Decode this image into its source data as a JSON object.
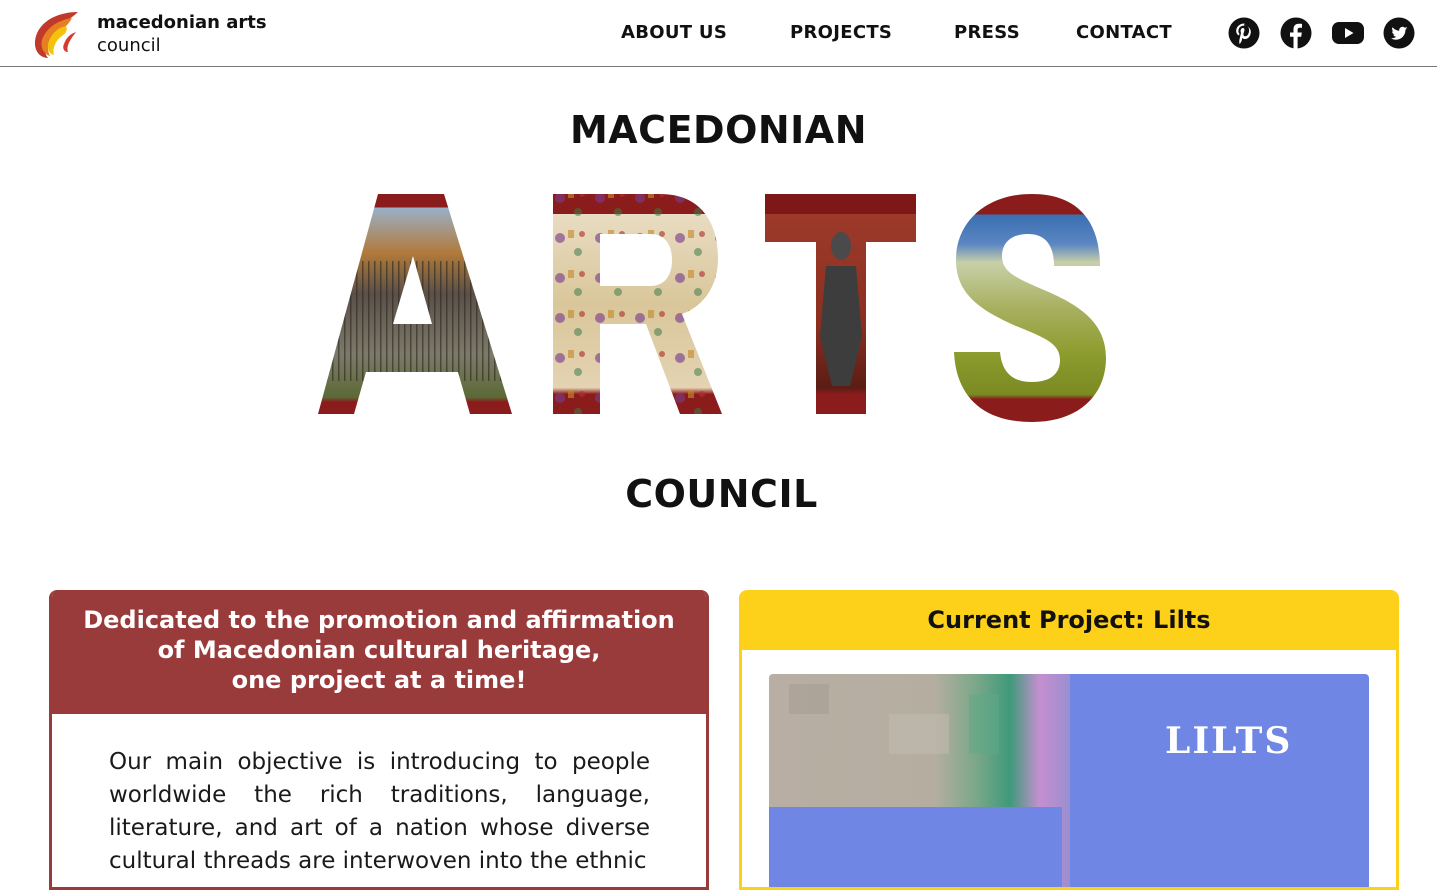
{
  "header": {
    "brand_line1": "macedonian arts",
    "brand_line2": "council",
    "nav": [
      "ABOUT US",
      "PROJECTS",
      "PRESS",
      "CONTACT"
    ],
    "social": [
      "pinterest-icon",
      "facebook-icon",
      "youtube-icon",
      "twitter-icon"
    ]
  },
  "hero": {
    "top": "MACEDONIAN",
    "middle": "ARTS",
    "bottom": "COUNCIL"
  },
  "mission": {
    "heading": [
      "Dedicated to the promotion and affirmation",
      "of Macedonian cultural heritage,",
      "one project at a time!"
    ],
    "body": "Our main objective is introducing to people worldwide the rich traditions, language, literature, and art of a nation whose diverse cultural threads are interwoven into the ethnic"
  },
  "current_project": {
    "heading": "Current Project: Lilts",
    "image_text": "LILTS"
  },
  "colors": {
    "brand_red": "#993a3b",
    "accent_yellow": "#fdd01a",
    "lilts_blue": "#6f86e4"
  }
}
